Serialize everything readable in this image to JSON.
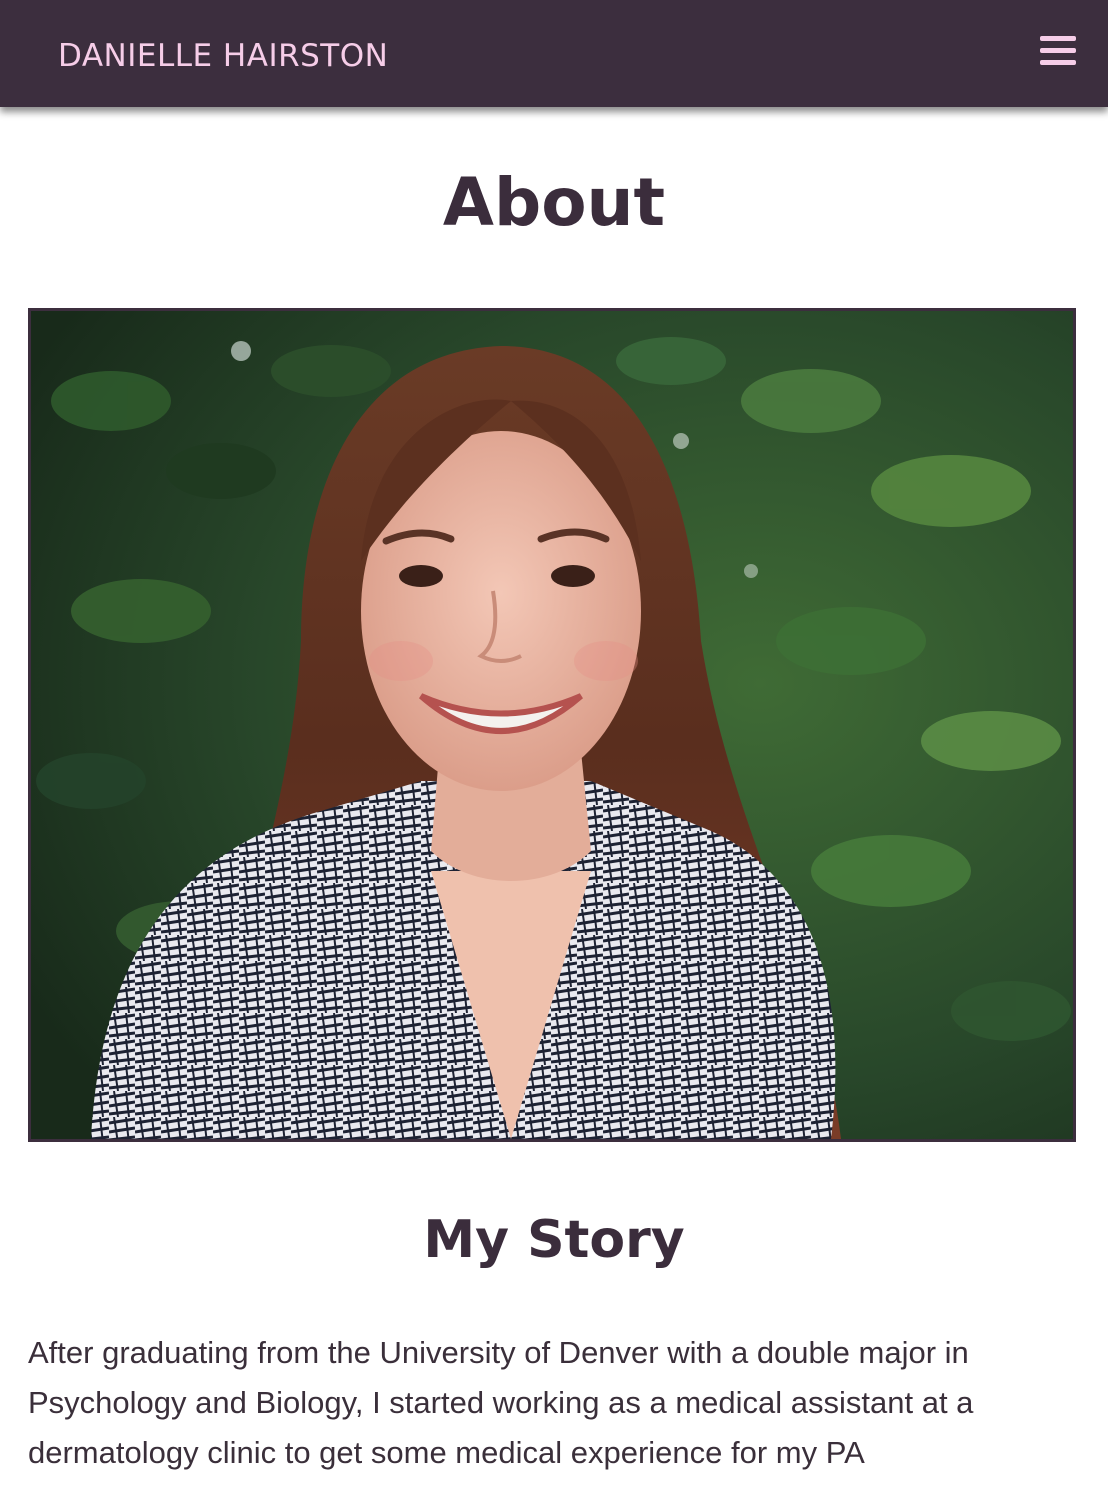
{
  "navbar": {
    "brand": "DANIELLE HAIRSTON",
    "menu_icon": "hamburger-menu-icon",
    "background": "#3c2e3e",
    "accent": "#f6cde8"
  },
  "main": {
    "title": "About",
    "photo_subject": "portrait",
    "section_title": "My Story",
    "paragraph": "After graduating from the University of Denver with a double major in Psychology and Biology, I started working as a medical assistant at a dermatology clinic to get some medical experience for my PA"
  }
}
